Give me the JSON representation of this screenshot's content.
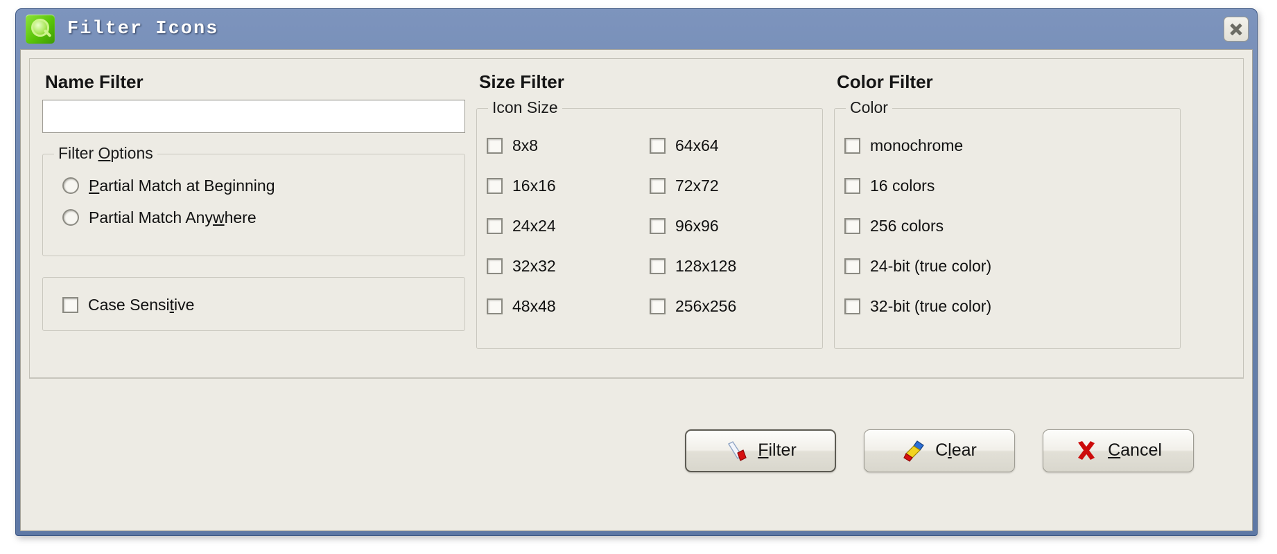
{
  "window": {
    "title": "Filter Icons",
    "app_icon": "magnifier-icon",
    "close_icon": "close-icon",
    "accent_color": "#6a83ad",
    "face_color": "#edebe4"
  },
  "name_filter": {
    "heading": "Name Filter",
    "input_value": "",
    "input_placeholder": "",
    "options_group": {
      "legend_before": "Filter ",
      "legend_accel": "O",
      "legend_after": "ptions",
      "radios": [
        {
          "before": "",
          "accel": "P",
          "after": "artial Match at Beginning",
          "checked": false
        },
        {
          "before": "Partial Match Any",
          "accel": "w",
          "after": "here",
          "checked": false
        }
      ]
    },
    "case_sensitive": {
      "before": "Case Sensi",
      "accel": "t",
      "after": "ive",
      "checked": false
    }
  },
  "size_filter": {
    "heading": "Size Filter",
    "group_legend": "Icon Size",
    "left_column": [
      {
        "label": "8x8",
        "checked": false
      },
      {
        "label": "16x16",
        "checked": false
      },
      {
        "label": "24x24",
        "checked": false
      },
      {
        "label": "32x32",
        "checked": false
      },
      {
        "label": "48x48",
        "checked": false
      }
    ],
    "right_column": [
      {
        "label": "64x64",
        "checked": false
      },
      {
        "label": "72x72",
        "checked": false
      },
      {
        "label": "96x96",
        "checked": false
      },
      {
        "label": "128x128",
        "checked": false
      },
      {
        "label": "256x256",
        "checked": false
      }
    ]
  },
  "color_filter": {
    "heading": "Color Filter",
    "group_legend": "Color",
    "items": [
      {
        "label": "monochrome",
        "checked": false
      },
      {
        "label": "16 colors",
        "checked": false
      },
      {
        "label": "256 colors",
        "checked": false
      },
      {
        "label": "24-bit (true color)",
        "checked": false
      },
      {
        "label": "32-bit (true color)",
        "checked": false
      }
    ]
  },
  "footer": {
    "buttons": [
      {
        "before": "",
        "accel": "F",
        "after": "ilter",
        "icon": "filter-brush-icon",
        "default": true
      },
      {
        "before": "C",
        "accel": "l",
        "after": "ear",
        "icon": "eraser-icon",
        "default": false
      },
      {
        "before": "",
        "accel": "C",
        "after": "ancel",
        "icon": "red-x-icon",
        "default": false
      }
    ]
  }
}
